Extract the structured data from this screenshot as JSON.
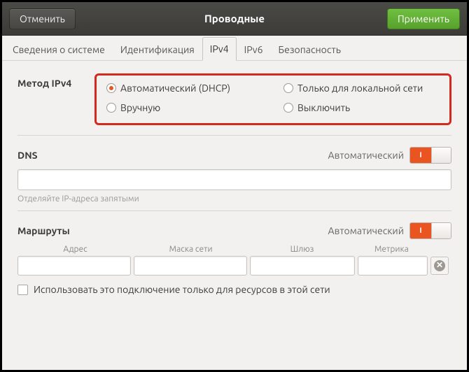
{
  "titlebar": {
    "cancel": "Отменить",
    "title": "Проводные",
    "apply": "Применить"
  },
  "tabs": [
    "Сведения о системе",
    "Идентификация",
    "IPv4",
    "IPv6",
    "Безопасность"
  ],
  "active_tab": 2,
  "method": {
    "label": "Метод IPv4",
    "options": {
      "auto": "Автоматический (DHCP)",
      "local": "Только для локальной сети",
      "manual": "Вручную",
      "off": "Выключить"
    },
    "selected": "auto"
  },
  "dns": {
    "title": "DNS",
    "auto_label": "Автоматический",
    "switch_on_text": "I",
    "value": "",
    "hint": "Отделяйте IP-адреса запятыми"
  },
  "routes": {
    "title": "Маршруты",
    "auto_label": "Автоматический",
    "switch_on_text": "I",
    "headers": {
      "address": "Адрес",
      "netmask": "Маска сети",
      "gateway": "Шлюз",
      "metric": "Метрика"
    },
    "row": {
      "address": "",
      "netmask": "",
      "gateway": "",
      "metric": ""
    },
    "only_local": "Использовать это подключение только для ресурсов в этой сети"
  }
}
